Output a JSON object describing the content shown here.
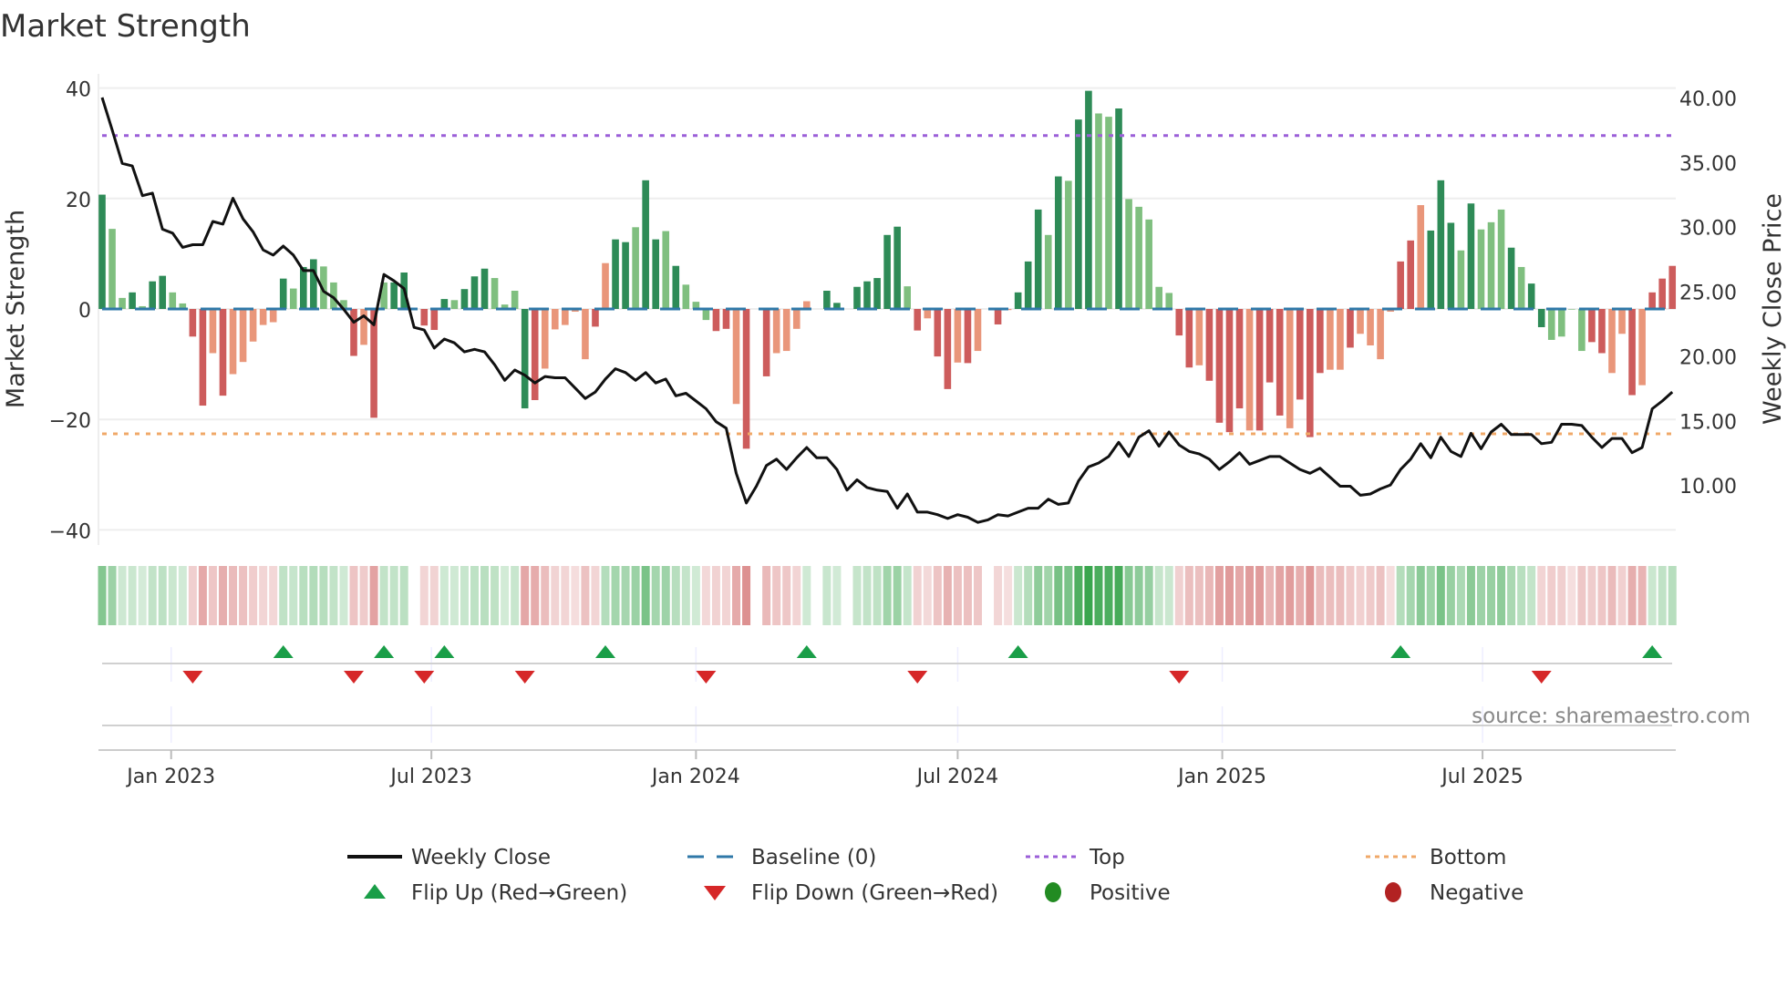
{
  "title": "Market Strength",
  "source": "source: sharemaestro.com",
  "colors": {
    "pos_strong": "#2e8b57",
    "pos_weak": "#7fbf7f",
    "neg_strong": "#cd5c5c",
    "neg_weak": "#e9967a",
    "baseline": "#2f78a8",
    "top": "#9b5fd8",
    "bottom": "#f0a868",
    "flip_up": "#1a9e48",
    "flip_down": "#d62728",
    "positive": "#228b22",
    "negative": "#b22222"
  },
  "chart_data": {
    "type": "bar",
    "title": "Market Strength",
    "ylabel": "Market Strength",
    "y2label": "Weekly Close Price",
    "ylim": [
      -42,
      42
    ],
    "y2lim": [
      5,
      41.3
    ],
    "yticks": [
      {
        "v": 40,
        "label": "40"
      },
      {
        "v": 20,
        "label": "20"
      },
      {
        "v": 0,
        "label": "0"
      },
      {
        "v": -20,
        "label": "−20"
      },
      {
        "v": -40,
        "label": "−40"
      }
    ],
    "y2ticks": [
      {
        "v": 40,
        "label": "40.00"
      },
      {
        "v": 35,
        "label": "35.00"
      },
      {
        "v": 30,
        "label": "30.00"
      },
      {
        "v": 25,
        "label": "25.00"
      },
      {
        "v": 20,
        "label": "20.00"
      },
      {
        "v": 15,
        "label": "15.00"
      },
      {
        "v": 10,
        "label": "10.00"
      }
    ],
    "xticks": [
      {
        "date": "2023-01-01",
        "label": "Jan 2023"
      },
      {
        "date": "2023-07-01",
        "label": "Jul 2023"
      },
      {
        "date": "2024-01-01",
        "label": "Jan 2024"
      },
      {
        "date": "2024-07-01",
        "label": "Jul 2024"
      },
      {
        "date": "2025-01-01",
        "label": "Jan 2025"
      },
      {
        "date": "2025-07-01",
        "label": "Jul 2025"
      }
    ],
    "start_week": "2022-11-14",
    "top": 31.4,
    "bottom": -22.6,
    "strength": [
      20.7,
      14.5,
      2,
      3,
      0.5,
      5,
      6,
      3,
      1,
      -5,
      -17.5,
      -8,
      -15.7,
      -11.8,
      -9.6,
      -5.9,
      -2.9,
      -2.4,
      5.5,
      3.7,
      7.6,
      9,
      7.7,
      4.8,
      1.6,
      -8.5,
      -6.5,
      -19.7,
      4.8,
      4.8,
      6.6,
      0,
      -3,
      -3.8,
      1.8,
      1.6,
      3.6,
      5.9,
      7.3,
      5.6,
      0.8,
      3.3,
      -18,
      -16.5,
      -10.8,
      -3.7,
      -2.9,
      -0.5,
      -9.1,
      -3.2,
      8.3,
      12.6,
      12.1,
      14.8,
      23.3,
      12.6,
      14.1,
      7.8,
      4.4,
      1.3,
      -2,
      -4,
      -3.6,
      -17.2,
      -25.3,
      0,
      -12.2,
      -8,
      -7.6,
      -3.6,
      1.4,
      0,
      3.3,
      1.1,
      0,
      4,
      5,
      5.6,
      13.4,
      14.9,
      4.1,
      -3.9,
      -1.7,
      -8.6,
      -14.5,
      -9.7,
      -9.8,
      -7.6,
      0,
      -2.8,
      -0.2,
      3,
      8.6,
      18,
      13.4,
      24,
      23.2,
      34.3,
      39.5,
      35.4,
      34.8,
      36.3,
      19.9,
      18.5,
      16.2,
      4,
      2.9,
      -4.8,
      -10.6,
      -10.2,
      -13,
      -20.6,
      -22.3,
      -18,
      -22,
      -22,
      -13.3,
      -19.3,
      -21.6,
      -16.4,
      -23.2,
      -11.6,
      -11,
      -11,
      -7,
      -4.5,
      -6.6,
      -9.1,
      -0.5,
      8.6,
      12.4,
      18.8,
      14.2,
      23.3,
      15.6,
      10.6,
      19.1,
      14.4,
      15.7,
      18,
      11.1,
      7.6,
      4.6,
      -3.3,
      -5.6,
      -5,
      -0.1,
      -7.6,
      -6,
      -8,
      -11.6,
      -4.5,
      -15.6,
      -13.8,
      3,
      5.5,
      7.8
    ],
    "strength_shade": "GggGgGGggRRrRrrrrrGgGGgggRrRgGGRRRGgGGGgggGRrrrrrRrGGgG GgGgggRRrRR RrrrrGGGgGGGGGgRrRRrRrRRrGGGgGgGGggGgggggRRrRRRRrRRRrRRRrrRrrrrRRrGGGgGgggGgGGggggRRrrRrRRRrRrGGG",
    "weekly_close": [
      40.0,
      37.5,
      34.9,
      34.7,
      32.4,
      32.6,
      29.8,
      29.5,
      28.4,
      28.6,
      28.6,
      30.4,
      30.2,
      32.2,
      30.6,
      29.6,
      28.2,
      27.8,
      28.5,
      27.8,
      26.6,
      26.6,
      25.0,
      24.5,
      23.6,
      22.6,
      23.1,
      22.4,
      26.3,
      25.8,
      25.2,
      22.2,
      22.0,
      20.6,
      21.3,
      21.0,
      20.3,
      20.5,
      20.3,
      19.3,
      18.1,
      18.9,
      18.5,
      17.9,
      18.4,
      18.3,
      18.3,
      17.5,
      16.7,
      17.2,
      18.2,
      19.0,
      18.7,
      18.1,
      18.7,
      17.9,
      18.2,
      16.9,
      17.1,
      16.5,
      15.9,
      14.9,
      14.4,
      10.9,
      8.6,
      9.9,
      11.5,
      12.0,
      11.2,
      12.1,
      12.9,
      12.1,
      12.1,
      11.2,
      9.6,
      10.4,
      9.8,
      9.6,
      9.5,
      8.2,
      9.3,
      7.9,
      7.9,
      7.7,
      7.4,
      7.7,
      7.5,
      7.1,
      7.3,
      7.7,
      7.6,
      7.9,
      8.2,
      8.2,
      8.9,
      8.5,
      8.6,
      10.3,
      11.4,
      11.7,
      12.2,
      13.3,
      12.2,
      13.7,
      14.2,
      13.0,
      14.1,
      13.1,
      12.6,
      12.4,
      12.0,
      11.2,
      11.8,
      12.5,
      11.6,
      11.9,
      12.2,
      12.2,
      11.7,
      11.2,
      10.9,
      11.3,
      10.6,
      9.9,
      9.9,
      9.2,
      9.3,
      9.7,
      10.0,
      11.2,
      12.0,
      13.2,
      12.1,
      13.7,
      12.6,
      12.2,
      14.0,
      12.8,
      14.1,
      14.7,
      13.9,
      13.9,
      13.9,
      13.2,
      13.3,
      14.7,
      14.7,
      14.6,
      13.7,
      12.9,
      13.6,
      13.6,
      12.5,
      12.9,
      15.9,
      16.5,
      17.2
    ],
    "flip_up_weeks": [
      18,
      28,
      34,
      50,
      70,
      91,
      129,
      154
    ],
    "flip_down_weeks": [
      9,
      25,
      32,
      42,
      60,
      81,
      107,
      143
    ]
  },
  "legend": [
    {
      "label": "Weekly Close",
      "key": "line"
    },
    {
      "label": "Baseline (0)",
      "key": "dash"
    },
    {
      "label": "Top",
      "key": "top"
    },
    {
      "label": "Bottom",
      "key": "bottom"
    },
    {
      "label": "Flip Up (Red→Green)",
      "key": "up"
    },
    {
      "label": "Flip Down (Green→Red)",
      "key": "down"
    },
    {
      "label": "Positive",
      "key": "pos"
    },
    {
      "label": "Negative",
      "key": "neg"
    }
  ]
}
